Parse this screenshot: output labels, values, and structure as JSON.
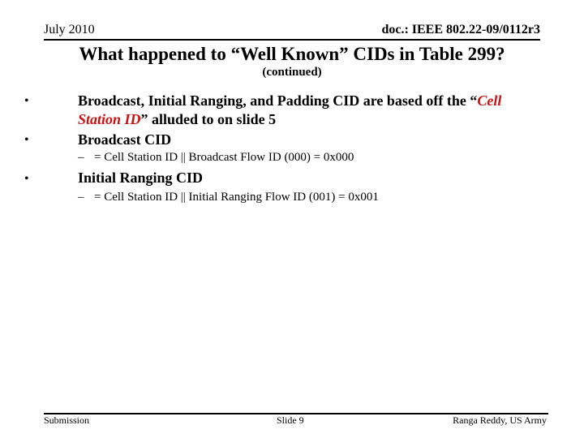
{
  "header": {
    "date": "July 2010",
    "doc_id": "doc.: IEEE 802.22-09/0112r3"
  },
  "slide": {
    "title": "What happened to “Well Known” CIDs in Table 299?",
    "subtitle": "(continued)",
    "bullets": [
      {
        "text_before": "Broadcast, Initial Ranging, and Padding CID are based off the “",
        "accent": "Cell Station ID",
        "text_after": "” alluded to on slide 5"
      },
      {
        "text": "Broadcast CID",
        "sub": "= Cell Station ID || Broadcast Flow ID (000) = 0x000"
      },
      {
        "text": "Initial Ranging CID",
        "sub": "= Cell Station ID || Initial Ranging Flow ID (001) = 0x001"
      }
    ],
    "bullet_glyph": "•",
    "dash_glyph": "–",
    "accent_color": "#cc1111"
  },
  "footer": {
    "left": "Submission",
    "center": "Slide 9",
    "right": "Ranga Reddy, US Army"
  }
}
